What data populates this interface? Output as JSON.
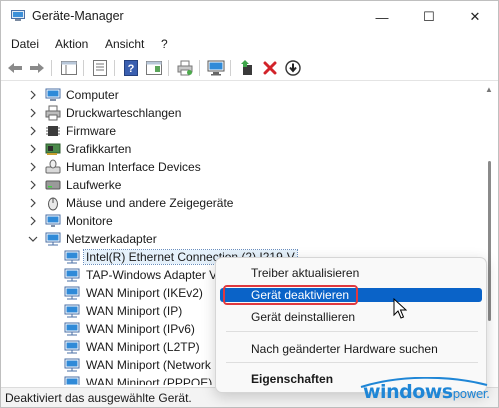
{
  "window": {
    "title": "Geräte-Manager",
    "min_glyph": "—",
    "max_glyph": "☐",
    "close_glyph": "✕"
  },
  "menu": [
    "Datei",
    "Aktion",
    "Ansicht",
    "?"
  ],
  "tree": {
    "categories": [
      {
        "label": "Computer",
        "icon": "computer-icon"
      },
      {
        "label": "Druckwarteschlangen",
        "icon": "printer-icon"
      },
      {
        "label": "Firmware",
        "icon": "chip-icon"
      },
      {
        "label": "Grafikkarten",
        "icon": "display-adapter-icon"
      },
      {
        "label": "Human Interface Devices",
        "icon": "hid-icon"
      },
      {
        "label": "Laufwerke",
        "icon": "drive-icon"
      },
      {
        "label": "Mäuse und andere Zeigegeräte",
        "icon": "mouse-icon"
      },
      {
        "label": "Monitore",
        "icon": "monitor-icon"
      }
    ],
    "network": {
      "label": "Netzwerkadapter",
      "children": [
        "Intel(R) Ethernet Connection (2) I219-V",
        "TAP-Windows Adapter V",
        "WAN Miniport (IKEv2)",
        "WAN Miniport (IP)",
        "WAN Miniport (IPv6)",
        "WAN Miniport (L2TP)",
        "WAN Miniport (Network",
        "WAN Miniport (PPPOE)"
      ]
    }
  },
  "context_menu": {
    "items": [
      "Treiber aktualisieren",
      "Gerät deaktivieren",
      "Gerät deinstallieren",
      "Nach geänderter Hardware suchen",
      "Eigenschaften"
    ],
    "highlight_color": "#0a63c8"
  },
  "status": "Deaktiviert das ausgewählte Gerät.",
  "watermark": {
    "main": "windows",
    "suffix": "power."
  }
}
